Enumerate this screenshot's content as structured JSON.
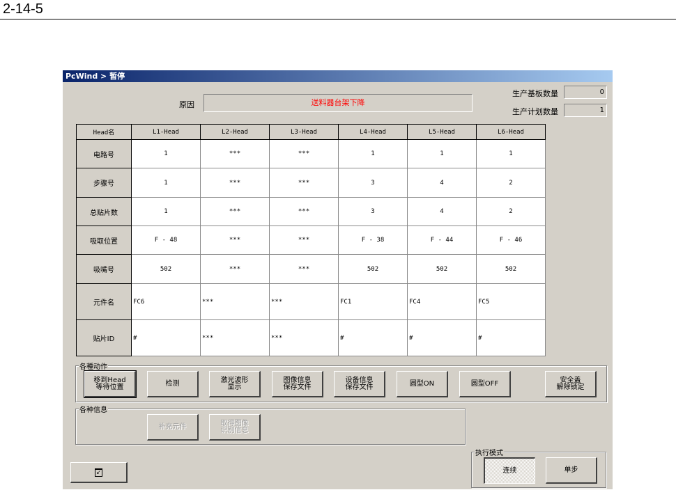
{
  "page_header": "2-14-5",
  "window": {
    "title": "PcWind > 暂停"
  },
  "reason": {
    "label": "原因",
    "value": "送料器台架下降",
    "color": "#ff0000"
  },
  "counters": [
    {
      "label": "生产基板数量",
      "value": "0"
    },
    {
      "label": "生产计划数量",
      "value": "1"
    }
  ],
  "table": {
    "headers": [
      "Head名",
      "L1-Head",
      "L2-Head",
      "L3-Head",
      "L4-Head",
      "L5-Head",
      "L6-Head"
    ],
    "rows": [
      {
        "label": "电路号",
        "cells": [
          "1",
          "***",
          "***",
          "1",
          "1",
          "1"
        ]
      },
      {
        "label": "步骤号",
        "cells": [
          "1",
          "***",
          "***",
          "3",
          "4",
          "2"
        ]
      },
      {
        "label": "总贴片数",
        "cells": [
          "1",
          "***",
          "***",
          "3",
          "4",
          "2"
        ]
      },
      {
        "label": "吸取位置",
        "cells": [
          "F - 48",
          "***",
          "***",
          "F - 38",
          "F - 44",
          "F - 46"
        ]
      },
      {
        "label": "吸嘴号",
        "cells": [
          "502",
          "***",
          "***",
          "502",
          "502",
          "502"
        ]
      },
      {
        "label": "元件名",
        "cells": [
          "FC6",
          "***",
          "***",
          "FC1",
          "FC4",
          "FC5"
        ]
      },
      {
        "label": "贴片ID",
        "cells": [
          "#",
          "***",
          "***",
          "#",
          "#",
          "#"
        ]
      }
    ]
  },
  "actions": {
    "title": "各種动作",
    "buttons": [
      "移到Head\n等待位置",
      "检测",
      "激光波形\n显示",
      "图像信息\n保存文件",
      "设备信息\n保存文件",
      "圆型ON",
      "圆型OFF",
      "安全盖\n解除锁定"
    ]
  },
  "info": {
    "title": "各种信息",
    "buttons": [
      "补充元件",
      "取得图像\n识别信息"
    ]
  },
  "mode": {
    "title": "执行模式",
    "buttons": [
      "连续",
      "单步"
    ]
  }
}
